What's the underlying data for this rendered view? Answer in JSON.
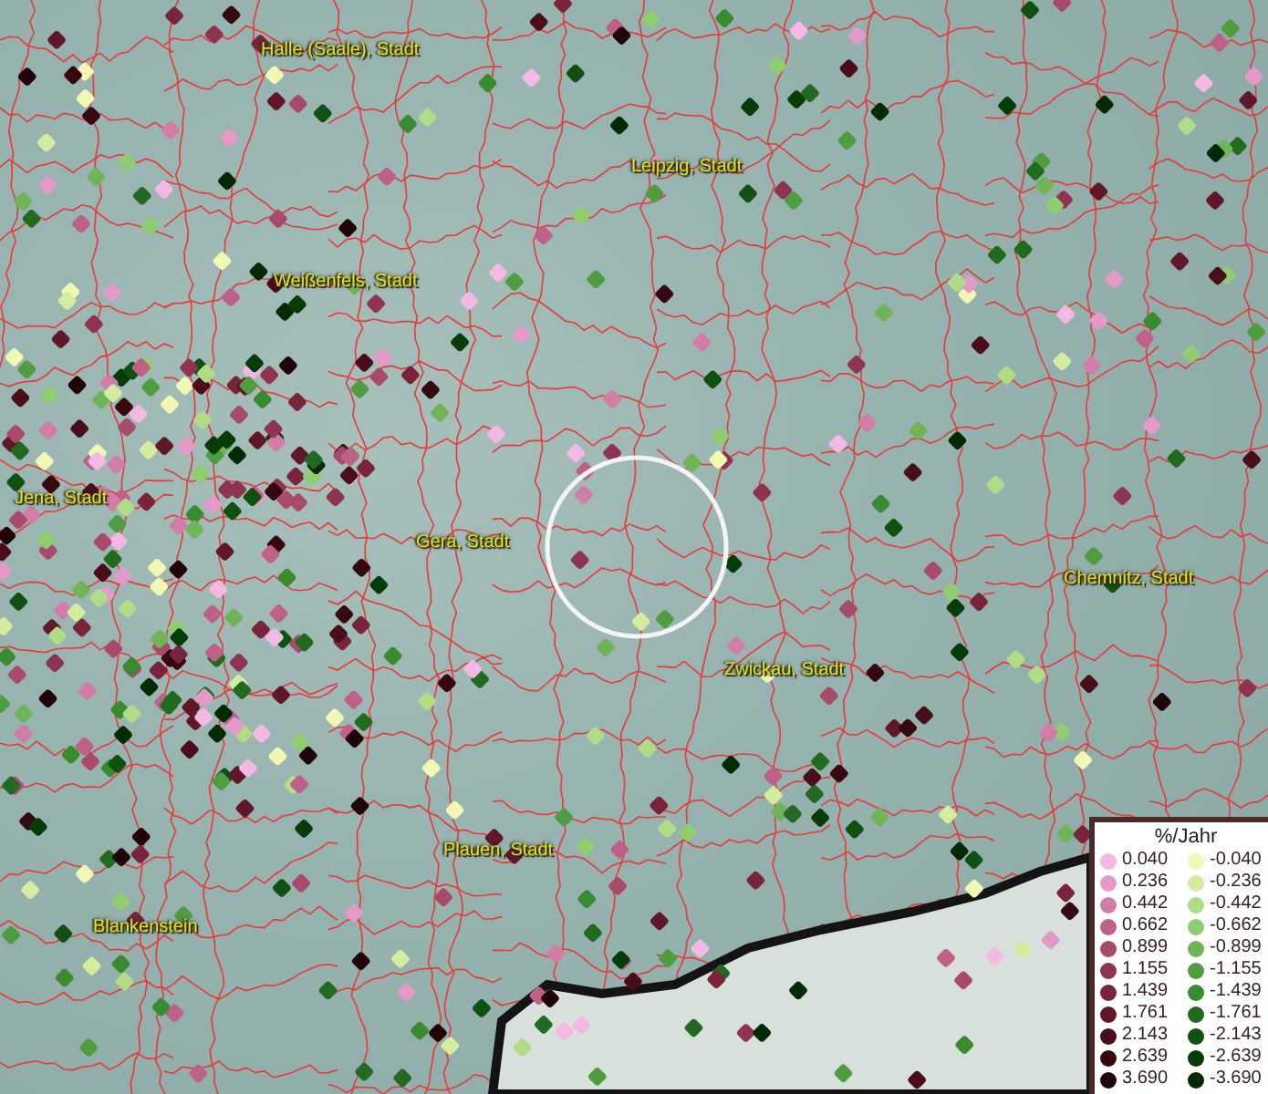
{
  "map": {
    "cities": [
      {
        "name": "Halle (Saale), Stadt"
      },
      {
        "name": "Leipzig, Stadt"
      },
      {
        "name": "Weißenfels, Stadt"
      },
      {
        "name": "Jena, Stadt"
      },
      {
        "name": "Gera, Stadt"
      },
      {
        "name": "Chemnitz, Stadt"
      },
      {
        "name": "Zwickau, Stadt"
      },
      {
        "name": "Plauen, Stadt"
      },
      {
        "name": "Blankenstein"
      }
    ]
  },
  "legend": {
    "title": "%/Jahr",
    "positive": [
      {
        "value": "0.040",
        "color": "#f4b8e4"
      },
      {
        "value": "0.236",
        "color": "#e49ac8"
      },
      {
        "value": "0.442",
        "color": "#d27ca8"
      },
      {
        "value": "0.662",
        "color": "#be6088"
      },
      {
        "value": "0.899",
        "color": "#a84a6a"
      },
      {
        "value": "1.155",
        "color": "#8e3450"
      },
      {
        "value": "1.439",
        "color": "#78243a"
      },
      {
        "value": "1.761",
        "color": "#601828"
      },
      {
        "value": "2.143",
        "color": "#4a0e1a"
      },
      {
        "value": "2.639",
        "color": "#360810"
      },
      {
        "value": "3.690",
        "color": "#200408"
      }
    ],
    "negative": [
      {
        "value": "-0.040",
        "color": "#f0f8b4"
      },
      {
        "value": "-0.236",
        "color": "#d4eca0"
      },
      {
        "value": "-0.442",
        "color": "#b0dc88"
      },
      {
        "value": "-0.662",
        "color": "#90cc70"
      },
      {
        "value": "-0.899",
        "color": "#70b458"
      },
      {
        "value": "-1.155",
        "color": "#509c40"
      },
      {
        "value": "-1.439",
        "color": "#3a8a30"
      },
      {
        "value": "-1.761",
        "color": "#226a20"
      },
      {
        "value": "-2.143",
        "color": "#105010"
      },
      {
        "value": "-2.639",
        "color": "#063c08"
      },
      {
        "value": "-3.690",
        "color": "#022a04"
      }
    ]
  }
}
